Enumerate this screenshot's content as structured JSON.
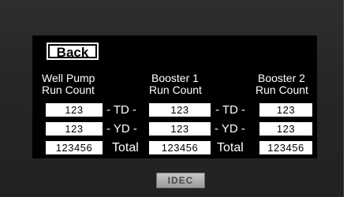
{
  "controls": {
    "back_label": "Back"
  },
  "columns": [
    {
      "line1": "Well Pump",
      "line2": "Run Count",
      "td": "123",
      "yd": "123",
      "total": "123456"
    },
    {
      "line1": "Booster 1",
      "line2": "Run Count",
      "td": "123",
      "yd": "123",
      "total": "123456"
    },
    {
      "line1": "Booster 2",
      "line2": "Run Count",
      "td": "123",
      "yd": "123",
      "total": "123456"
    }
  ],
  "separators": {
    "td": "- TD -",
    "yd": "- YD -",
    "total": "Total"
  },
  "device": {
    "brand": "IDEC"
  },
  "colors": {
    "bezel": "#262626",
    "screen": "#000000",
    "field": "#ffffff",
    "text": "#ffffff"
  }
}
